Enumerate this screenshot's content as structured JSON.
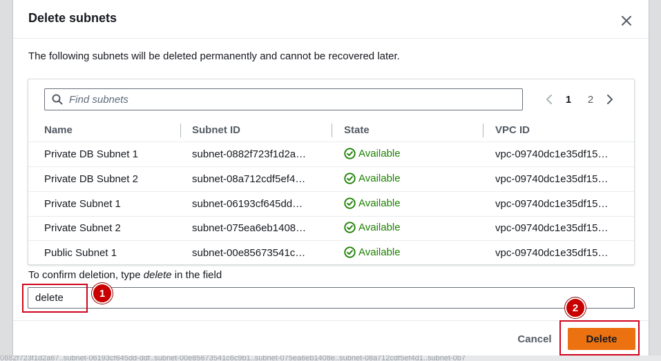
{
  "modal": {
    "title": "Delete subnets",
    "description": "The following subnets will be deleted permanently and cannot be recovered later."
  },
  "search": {
    "placeholder": "Find subnets"
  },
  "pagination": {
    "pages": [
      "1",
      "2"
    ],
    "current": "1"
  },
  "table": {
    "headers": [
      "Name",
      "Subnet ID",
      "State",
      "VPC ID"
    ],
    "rows": [
      {
        "name": "Private DB Subnet 1",
        "subnet_id": "subnet-0882f723f1d2a…",
        "state": "Available",
        "vpc_id": "vpc-09740dc1e35df15…"
      },
      {
        "name": "Private DB Subnet 2",
        "subnet_id": "subnet-08a712cdf5ef4…",
        "state": "Available",
        "vpc_id": "vpc-09740dc1e35df15…"
      },
      {
        "name": "Private Subnet 1",
        "subnet_id": "subnet-06193cf645dd…",
        "state": "Available",
        "vpc_id": "vpc-09740dc1e35df15…"
      },
      {
        "name": "Private Subnet 2",
        "subnet_id": "subnet-075ea6eb1408…",
        "state": "Available",
        "vpc_id": "vpc-09740dc1e35df15…"
      },
      {
        "name": "Public Subnet 1",
        "subnet_id": "subnet-00e85673541c…",
        "state": "Available",
        "vpc_id": "vpc-09740dc1e35df15…"
      }
    ]
  },
  "confirm": {
    "label_prefix": "To confirm deletion, type ",
    "label_keyword": "delete",
    "label_suffix": " in the field",
    "value": "delete"
  },
  "footer": {
    "cancel_label": "Cancel",
    "delete_label": "Delete"
  },
  "annotations": {
    "step1": "1",
    "step2": "2"
  },
  "background_text": "0882f723f1d2a67..subnet-06193cf645dd-ddf..subnet-00e85673541c6c9b1..subnet-075ea6eb1408e..subnet-08a712cdf5ef4d1..subnet-0b7"
}
